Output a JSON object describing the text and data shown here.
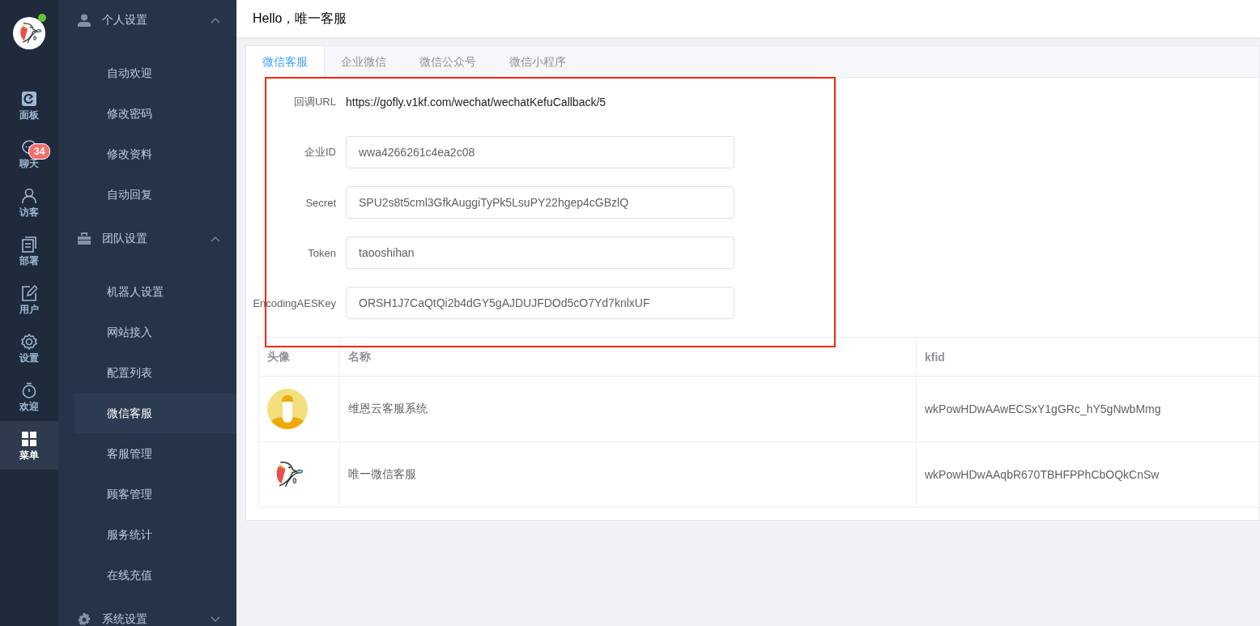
{
  "rail": {
    "online": true,
    "items": [
      {
        "label": "面板",
        "selected": false
      },
      {
        "label": "聊天",
        "selected": false,
        "badge": "34"
      },
      {
        "label": "访客",
        "selected": false
      },
      {
        "label": "部署",
        "selected": false
      },
      {
        "label": "用户",
        "selected": false
      },
      {
        "label": "设置",
        "selected": false
      },
      {
        "label": "欢迎",
        "selected": false
      },
      {
        "label": "菜单",
        "selected": true
      }
    ]
  },
  "menu": [
    {
      "label": "个人设置",
      "expanded": true,
      "children": [
        {
          "label": "自动欢迎",
          "selected": false
        },
        {
          "label": "修改密码",
          "selected": false
        },
        {
          "label": "修改资料",
          "selected": false
        },
        {
          "label": "自动回复",
          "selected": false
        }
      ]
    },
    {
      "label": "团队设置",
      "expanded": true,
      "children": [
        {
          "label": "机器人设置",
          "selected": false
        },
        {
          "label": "网站接入",
          "selected": false
        },
        {
          "label": "配置列表",
          "selected": false
        },
        {
          "label": "微信客服",
          "selected": true
        },
        {
          "label": "客服管理",
          "selected": false
        },
        {
          "label": "顾客管理",
          "selected": false
        },
        {
          "label": "服务统计",
          "selected": false
        },
        {
          "label": "在线充值",
          "selected": false
        }
      ]
    },
    {
      "label": "系统设置",
      "expanded": false
    }
  ],
  "header": {
    "greeting": "Hello，唯一客服"
  },
  "tabs": [
    {
      "label": "微信客服",
      "selected": true
    },
    {
      "label": "企业微信",
      "selected": false
    },
    {
      "label": "微信公众号",
      "selected": false
    },
    {
      "label": "微信小程序",
      "selected": false
    }
  ],
  "form": [
    {
      "kind": "text",
      "label": "回调URL",
      "value": "https://gofly.v1kf.com/wechat/wechatKefuCallback/5"
    },
    {
      "kind": "input",
      "label": "企业ID",
      "value": "wwa4266261c4ea2c08"
    },
    {
      "kind": "input",
      "label": "Secret",
      "value": "SPU2s8t5cml3GfkAuggiTyPk5LsuPY22hgep4cGBzlQ"
    },
    {
      "kind": "input",
      "label": "Token",
      "value": "taooshihan"
    },
    {
      "kind": "input",
      "label": "EncodingAESKey",
      "value": "ORSH1J7CaQtQi2b4dGY5gAJDUJFDOd5cO7Yd7knlxUF"
    }
  ],
  "table": {
    "columns": [
      "头像",
      "名称",
      "kfid"
    ],
    "rows": [
      {
        "name": "维恩云客服系统",
        "kfid": "wkPowHDwAAwECSxY1gGRc_hY5gNwbMmg"
      },
      {
        "name": "唯一微信客服",
        "kfid": "wkPowHDwAAqbR670TBHFPPhCbOQkCnSw"
      }
    ]
  }
}
